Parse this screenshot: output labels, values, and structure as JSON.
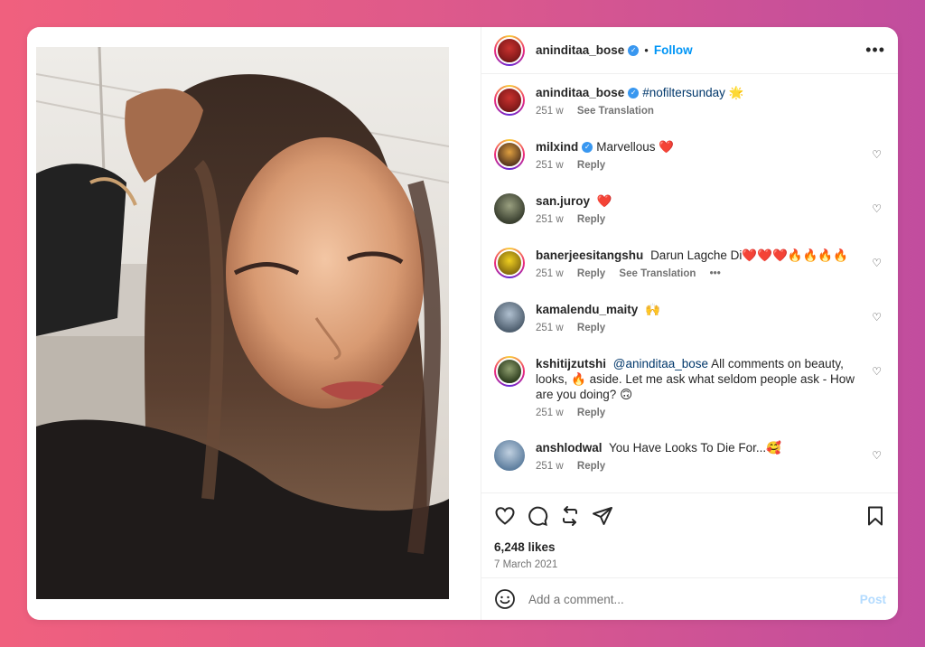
{
  "post": {
    "username": "aninditaa_bose",
    "follow_label": "Follow",
    "dot": "•",
    "more": "•••"
  },
  "caption": {
    "username": "aninditaa_bose",
    "hashtag": "#nofiltersunday",
    "emoji": "🌟",
    "time": "251 w",
    "translate": "See Translation"
  },
  "comments": [
    {
      "user": "milxind",
      "verified": true,
      "text": "Marvellous ❤️",
      "time": "251 w",
      "reply": "Reply"
    },
    {
      "user": "san.juroy",
      "verified": false,
      "text": "❤️",
      "time": "251 w",
      "reply": "Reply"
    },
    {
      "user": "banerjeesitangshu",
      "verified": false,
      "text": "Darun Lagche Di❤️❤️❤️🔥🔥🔥🔥",
      "time": "251 w",
      "reply": "Reply",
      "translate": "See Translation",
      "more": "•••"
    },
    {
      "user": "kamalendu_maity",
      "verified": false,
      "text": "🙌",
      "time": "251 w",
      "reply": "Reply"
    },
    {
      "user": "kshitijzutshi",
      "verified": false,
      "mention": "@aninditaa_bose",
      "text": "All comments on beauty, looks, 🔥 aside. Let me ask what seldom people ask - How are you doing? 🙃",
      "time": "251 w",
      "reply": "Reply"
    },
    {
      "user": "anshlodwal",
      "verified": false,
      "text": "You Have Looks To Die For...🥰",
      "time": "251 w",
      "reply": "Reply"
    }
  ],
  "stats": {
    "likes": "6,248 likes",
    "date": "7 March 2021"
  },
  "add_comment": {
    "placeholder": "Add a comment...",
    "post_label": "Post"
  },
  "colors": {
    "accent": "#0095f6",
    "post_disabled": "#b3dbff",
    "verified": "#3897f0"
  },
  "icons": [
    "heart-icon",
    "comment-icon",
    "repost-icon",
    "share-icon",
    "bookmark-icon",
    "emoji-icon",
    "verified-icon",
    "more-icon"
  ]
}
